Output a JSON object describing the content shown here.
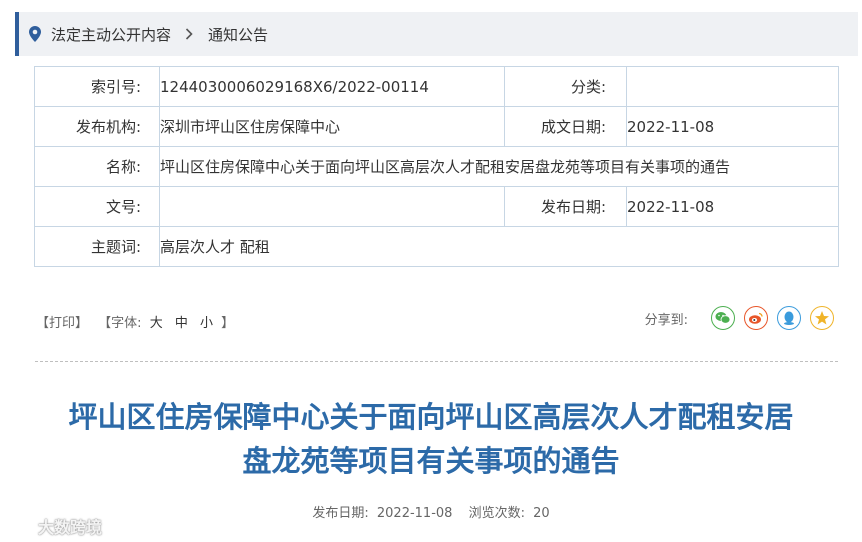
{
  "breadcrumb": {
    "items": [
      "法定主动公开内容",
      "通知公告"
    ]
  },
  "meta": {
    "index_no_label": "索引号:",
    "index_no_value": "1244030006029168X6/2022-00114",
    "category_label": "分类:",
    "category_value": "",
    "issuer_label": "发布机构:",
    "issuer_value": "深圳市坪山区住房保障中心",
    "doc_date_label": "成文日期:",
    "doc_date_value": "2022-11-08",
    "name_label": "名称:",
    "name_value": "坪山区住房保障中心关于面向坪山区高层次人才配租安居盘龙苑等项目有关事项的通告",
    "doc_no_label": "文号:",
    "doc_no_value": "",
    "pub_date_label": "发布日期:",
    "pub_date_value": "2022-11-08",
    "topic_label": "主题词:",
    "topic_value": "高层次人才 配租"
  },
  "tools": {
    "print": "【打印】",
    "font_open": "【字体:",
    "size_large": "大",
    "size_medium": "中",
    "size_small": "小",
    "font_close": "】",
    "share_label": "分享到:",
    "share_icons": [
      "wechat-icon",
      "weibo-icon",
      "qq-icon",
      "qzone-icon"
    ]
  },
  "article": {
    "title_line1": "坪山区住房保障中心关于面向坪山区高层次人才配租安居",
    "title_line2": "盘龙苑等项目有关事项的通告",
    "pub_label": "发布日期:",
    "pub_value": "2022-11-08",
    "views_label": "浏览次数:",
    "views_value": "20"
  },
  "watermark": "大数跨境",
  "colors": {
    "accent": "#2f5e9c",
    "title": "#2c6aa8",
    "wechat": "#4caf50",
    "weibo": "#e8562a",
    "qq": "#3a9bdc",
    "qzone": "#f0b429"
  }
}
